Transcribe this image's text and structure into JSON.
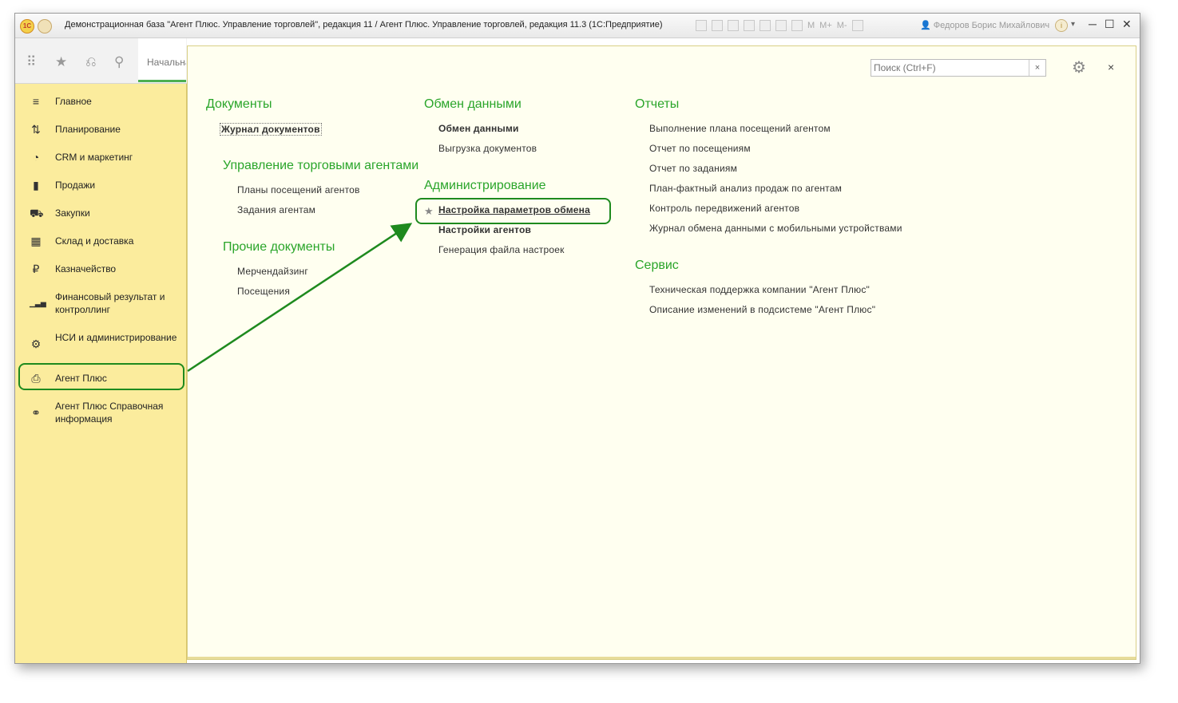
{
  "window": {
    "title": "Демонстрационная база \"Агент Плюс. Управление торговлей\", редакция 11 / Агент Плюс. Управление торговлей, редакция 11.3 (1С:Предприятие)",
    "memory_buttons": [
      "M",
      "M+",
      "M-"
    ],
    "user": "Федоров Борис Михайлович",
    "logo": "1С",
    "info_icon": "i",
    "dropdown_icon": "▾",
    "minimize": "─",
    "maximize": "☐",
    "close": "✕"
  },
  "toolbar": {
    "icons": [
      "apps-icon",
      "star-icon",
      "history-icon",
      "search-icon"
    ],
    "apps_glyph": "⠿",
    "star_glyph": "★",
    "history_glyph": "⎌",
    "search_glyph": "⚲",
    "tab_start": "Начальная страница"
  },
  "sidebar": {
    "items": [
      {
        "label": "Главное",
        "icon": "≡",
        "icon_name": "menu-icon"
      },
      {
        "label": "Планирование",
        "icon": "⇅",
        "icon_name": "planning-icon"
      },
      {
        "label": "CRM и маркетинг",
        "icon": "◔",
        "icon_name": "pie-icon"
      },
      {
        "label": "Продажи",
        "icon": "▮",
        "icon_name": "bag-icon"
      },
      {
        "label": "Закупки",
        "icon": "⛟",
        "icon_name": "cart-icon"
      },
      {
        "label": "Склад и доставка",
        "icon": "▦",
        "icon_name": "warehouse-icon"
      },
      {
        "label": "Казначейство",
        "icon": "₽",
        "icon_name": "ruble-icon"
      },
      {
        "label": "Финансовый результат и контроллинг",
        "icon": "▁▃▅",
        "icon_name": "bar-chart-icon"
      },
      {
        "label": "НСИ и администрирование",
        "icon": "⚙",
        "icon_name": "settings-icon"
      },
      {
        "label": "Агент Плюс",
        "icon": "⎙",
        "icon_name": "agent-plus-icon"
      },
      {
        "label": "Агент Плюс Справочная информация",
        "icon": "⚭",
        "icon_name": "link-icon"
      }
    ]
  },
  "panel": {
    "search_placeholder": "Поиск (Ctrl+F)",
    "search_clear": "×",
    "settings_icon": "⚙",
    "close": "×",
    "groups": {
      "documents": {
        "title": "Документы",
        "links": [
          "Журнал документов"
        ]
      },
      "agents": {
        "title": "Управление торговыми агентами",
        "links": [
          "Планы посещений агентов",
          "Задания агентам"
        ]
      },
      "other_docs": {
        "title": "Прочие документы",
        "links": [
          "Мерчендайзинг",
          "Посещения"
        ]
      },
      "exchange": {
        "title": "Обмен данными",
        "links": [
          "Обмен данными",
          "Выгрузка документов"
        ]
      },
      "admin": {
        "title": "Администрирование",
        "links": [
          "Настройка параметров обмена",
          "Настройки агентов",
          "Генерация файла настроек"
        ]
      },
      "reports": {
        "title": "Отчеты",
        "links": [
          "Выполнение плана посещений агентом",
          "Отчет по посещениям",
          "Отчет по заданиям",
          "План-фактный анализ продаж по агентам",
          "Контроль передвижений агентов",
          "Журнал обмена данными с мобильными устройствами"
        ]
      },
      "service": {
        "title": "Сервис",
        "links": [
          "Техническая поддержка компании \"Агент Плюс\"",
          "Описание изменений в подсистеме \"Агент Плюс\""
        ]
      }
    },
    "favorite_star": "★"
  },
  "colors": {
    "sidebar_bg": "#fbec9d",
    "panel_bg": "#fffff0",
    "group_title": "#2aa52a",
    "highlight": "#1e8a1e"
  }
}
